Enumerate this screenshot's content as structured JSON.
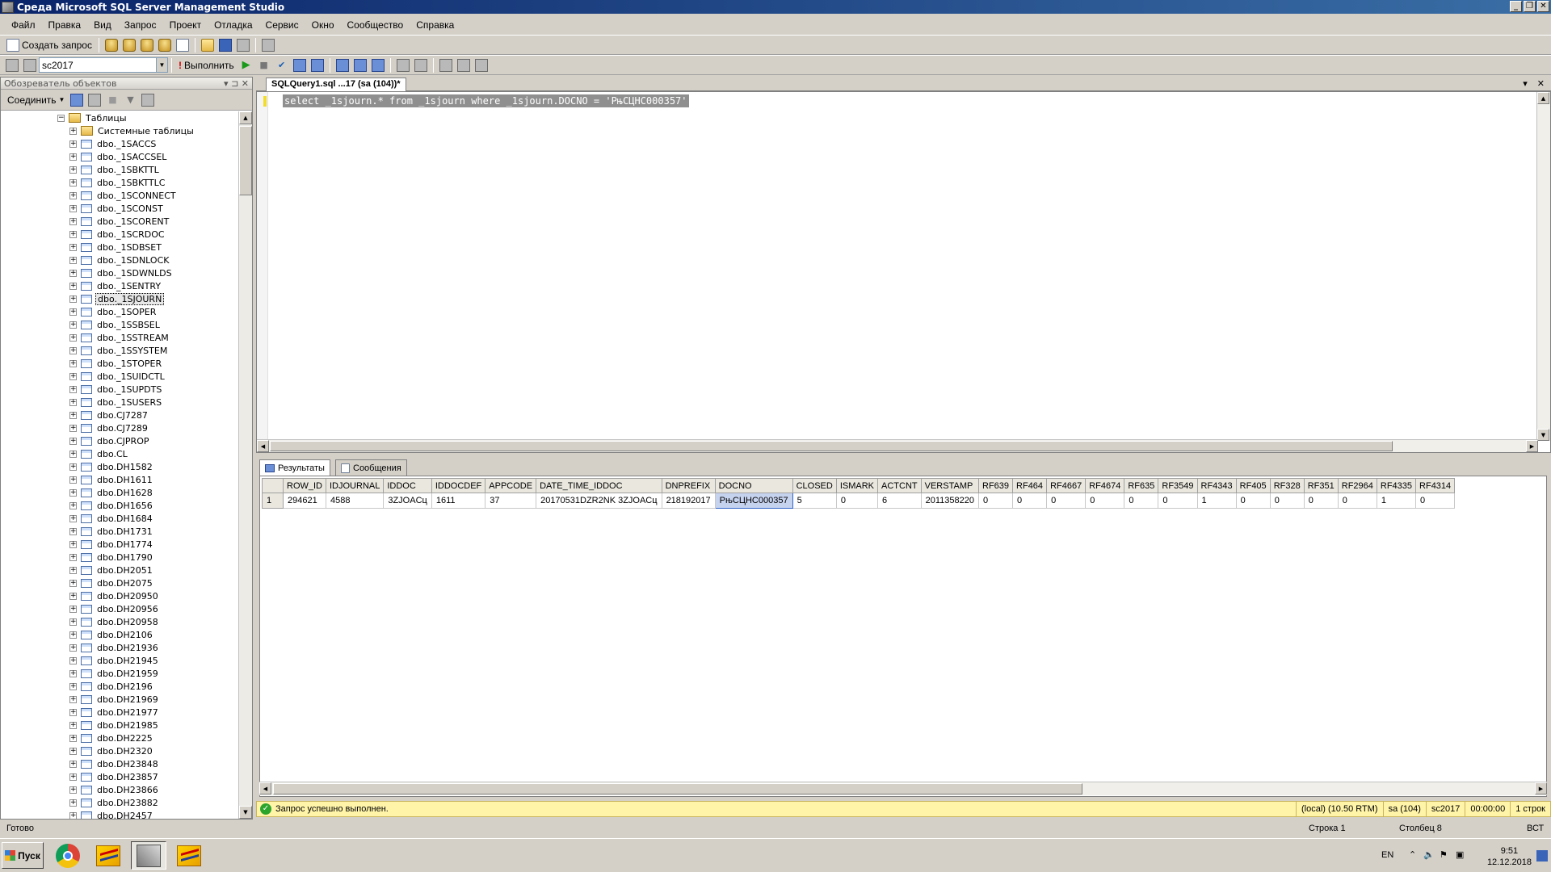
{
  "window": {
    "title": "Среда Microsoft SQL Server Management Studio"
  },
  "menu": [
    "Файл",
    "Правка",
    "Вид",
    "Запрос",
    "Проект",
    "Отладка",
    "Сервис",
    "Окно",
    "Сообщество",
    "Справка"
  ],
  "toolbar": {
    "new_query": "Создать запрос",
    "database": "sc2017",
    "execute": "Выполнить"
  },
  "object_explorer": {
    "title": "Обозреватель объектов",
    "connect": "Соединить",
    "tree": {
      "tables_folder": "Таблицы",
      "system_tables": "Системные таблицы",
      "selected": "dbo._1SJOURN",
      "items": [
        "dbo._1SACCS",
        "dbo._1SACCSEL",
        "dbo._1SBKTTL",
        "dbo._1SBKTTLC",
        "dbo._1SCONNECT",
        "dbo._1SCONST",
        "dbo._1SCORENT",
        "dbo._1SCRDOC",
        "dbo._1SDBSET",
        "dbo._1SDNLOCK",
        "dbo._1SDWNLDS",
        "dbo._1SENTRY",
        "dbo._1SJOURN",
        "dbo._1SOPER",
        "dbo._1SSBSEL",
        "dbo._1SSTREAM",
        "dbo._1SSYSTEM",
        "dbo._1STOPER",
        "dbo._1SUIDCTL",
        "dbo._1SUPDTS",
        "dbo._1SUSERS",
        "dbo.CJ7287",
        "dbo.CJ7289",
        "dbo.CJPROP",
        "dbo.CL",
        "dbo.DH1582",
        "dbo.DH1611",
        "dbo.DH1628",
        "dbo.DH1656",
        "dbo.DH1684",
        "dbo.DH1731",
        "dbo.DH1774",
        "dbo.DH1790",
        "dbo.DH2051",
        "dbo.DH2075",
        "dbo.DH20950",
        "dbo.DH20956",
        "dbo.DH20958",
        "dbo.DH2106",
        "dbo.DH21936",
        "dbo.DH21945",
        "dbo.DH21959",
        "dbo.DH2196",
        "dbo.DH21969",
        "dbo.DH21977",
        "dbo.DH21985",
        "dbo.DH2225",
        "dbo.DH2320",
        "dbo.DH23848",
        "dbo.DH23857",
        "dbo.DH23866",
        "dbo.DH23882",
        "dbo.DH2457"
      ]
    }
  },
  "editor": {
    "tab": "SQLQuery1.sql ...17 (sa (104))*",
    "sql": "select _1sjourn.* from _1sjourn where _1sjourn.DOCNO = 'РњСЦНС000357'"
  },
  "results": {
    "tabs": [
      "Результаты",
      "Сообщения"
    ],
    "columns": [
      "ROW_ID",
      "IDJOURNAL",
      "IDDOC",
      "IDDOCDEF",
      "APPCODE",
      "DATE_TIME_IDDOC",
      "DNPREFIX",
      "DOCNO",
      "CLOSED",
      "ISMARK",
      "ACTCNT",
      "VERSTAMP",
      "RF639",
      "RF464",
      "RF4667",
      "RF4674",
      "RF635",
      "RF3549",
      "RF4343",
      "RF405",
      "RF328",
      "RF351",
      "RF2964",
      "RF4335",
      "RF4314"
    ],
    "rows": [
      {
        "num": "1",
        "cells": [
          "294621",
          "4588",
          "3ZJOACц",
          "1611",
          "37",
          "20170531DZR2NK 3ZJOACц",
          "218192017",
          "РњСЦНС000357",
          "5",
          "0",
          "6",
          "2011358220",
          "0",
          "0",
          "0",
          "0",
          "0",
          "0",
          "1",
          "0",
          "0",
          "0",
          "0",
          "1",
          "0"
        ]
      }
    ]
  },
  "query_status": {
    "message": "Запрос успешно выполнен.",
    "server": "(local) (10.50 RTM)",
    "user": "sa (104)",
    "db": "sc2017",
    "time": "00:00:00",
    "rows": "1 строк"
  },
  "statusbar": {
    "ready": "Готово",
    "line": "Строка 1",
    "col": "Столбец 8",
    "mode": "ВСТ"
  },
  "taskbar": {
    "start": "Пуск",
    "lang": "EN",
    "time": "9:51",
    "date": "12.12.2018"
  }
}
